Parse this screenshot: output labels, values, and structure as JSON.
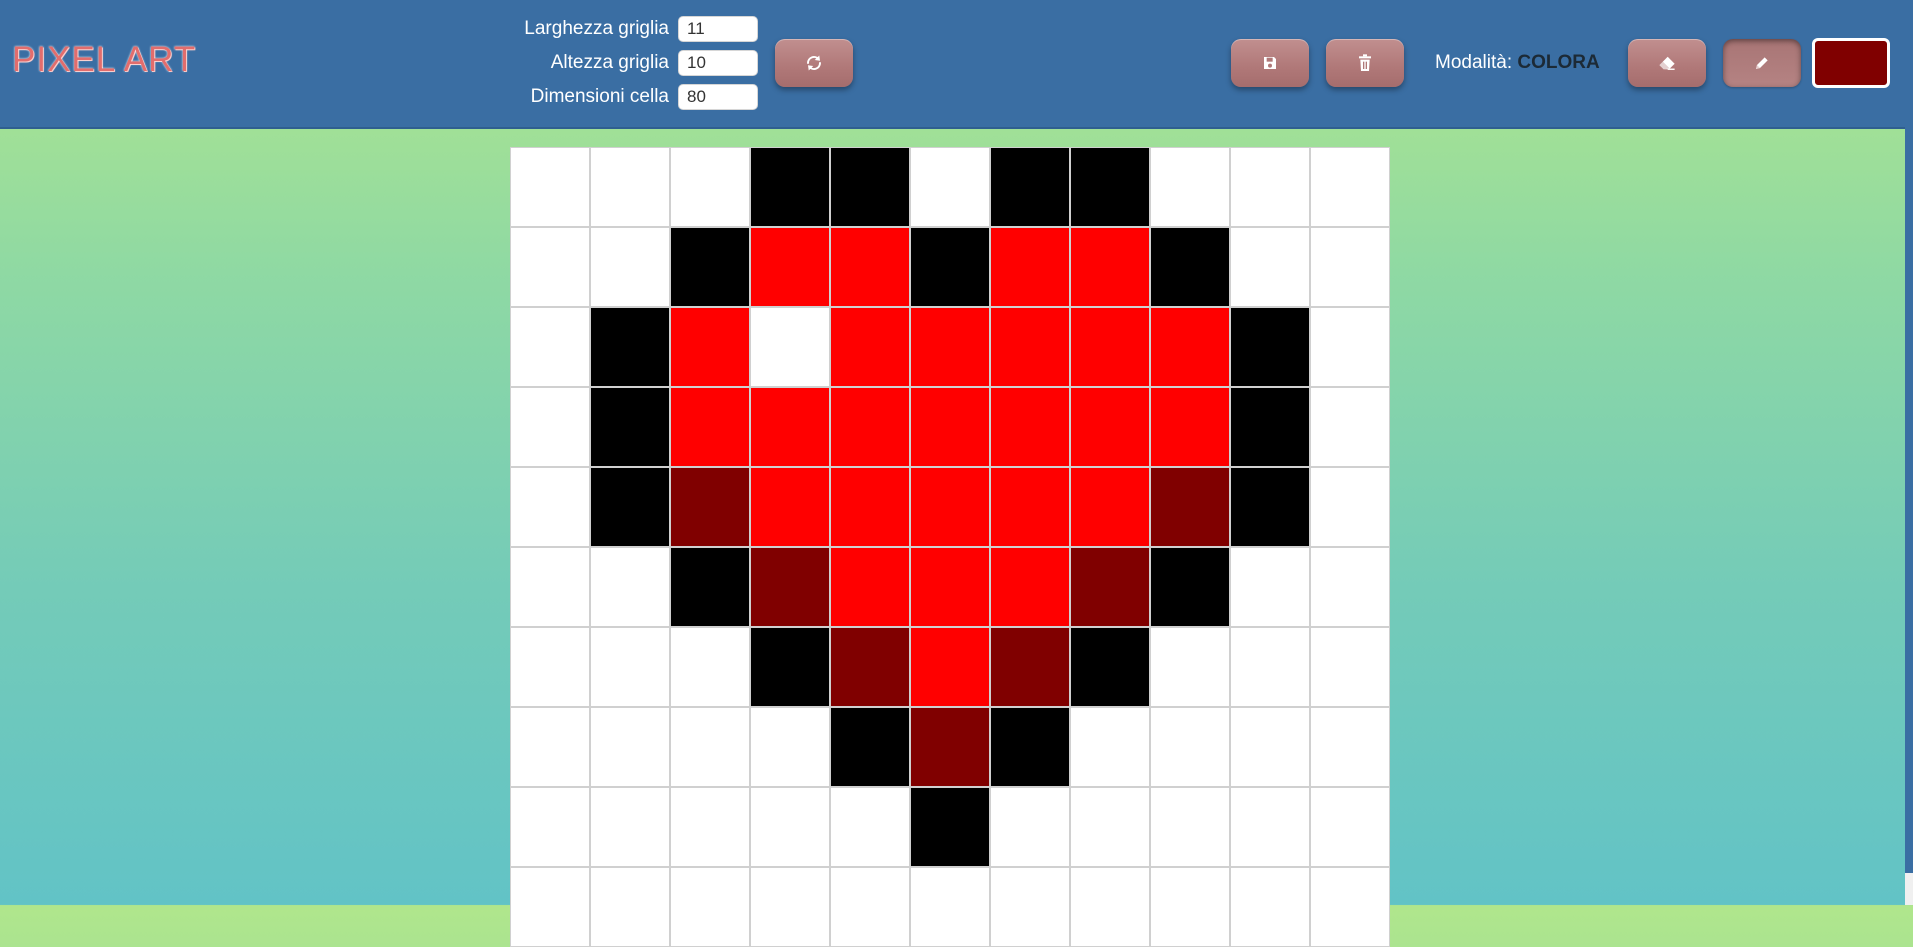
{
  "app": {
    "title": "PIXEL ART"
  },
  "controls": {
    "width_label": "Larghezza griglia",
    "width_value": "11",
    "height_label": "Altezza griglia",
    "height_value": "10",
    "cell_label": "Dimensioni cella",
    "cell_value": "80"
  },
  "toolbar": {
    "refresh_icon": "refresh-icon",
    "save_icon": "save-icon",
    "delete_icon": "trash-icon",
    "mode_label": "Modalità:",
    "mode_value": "COLORA",
    "eraser_icon": "eraser-icon",
    "pencil_icon": "pencil-icon",
    "current_color": "#800000"
  },
  "palette": {
    "w": "#ffffff",
    "k": "#000000",
    "r": "#ff0000",
    "d": "#800000"
  },
  "grid": {
    "columns": 11,
    "rows": [
      [
        "w",
        "w",
        "w",
        "k",
        "k",
        "w",
        "k",
        "k",
        "w",
        "w",
        "w"
      ],
      [
        "w",
        "w",
        "k",
        "r",
        "r",
        "k",
        "r",
        "r",
        "k",
        "w",
        "w"
      ],
      [
        "w",
        "k",
        "r",
        "w",
        "r",
        "r",
        "r",
        "r",
        "r",
        "k",
        "w"
      ],
      [
        "w",
        "k",
        "r",
        "r",
        "r",
        "r",
        "r",
        "r",
        "r",
        "k",
        "w"
      ],
      [
        "w",
        "k",
        "d",
        "r",
        "r",
        "r",
        "r",
        "r",
        "d",
        "k",
        "w"
      ],
      [
        "w",
        "w",
        "k",
        "d",
        "r",
        "r",
        "r",
        "d",
        "k",
        "w",
        "w"
      ],
      [
        "w",
        "w",
        "w",
        "k",
        "d",
        "r",
        "d",
        "k",
        "w",
        "w",
        "w"
      ],
      [
        "w",
        "w",
        "w",
        "w",
        "k",
        "d",
        "k",
        "w",
        "w",
        "w",
        "w"
      ],
      [
        "w",
        "w",
        "w",
        "w",
        "w",
        "k",
        "w",
        "w",
        "w",
        "w",
        "w"
      ],
      [
        "w",
        "w",
        "w",
        "w",
        "w",
        "w",
        "w",
        "w",
        "w",
        "w",
        "w"
      ]
    ]
  }
}
